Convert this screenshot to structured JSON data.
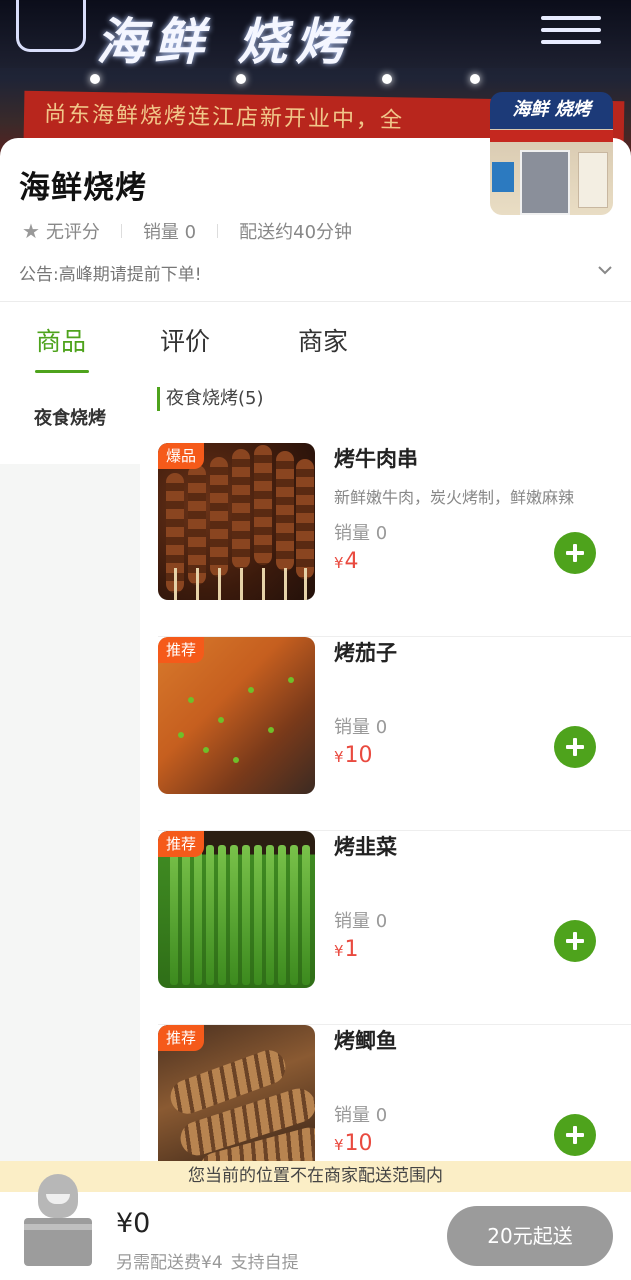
{
  "shop": {
    "name": "海鲜烧烤",
    "rating": "无评分",
    "sales": "销量 0",
    "delivery_time": "配送约40分钟",
    "notice": "公告:高峰期请提前下单!"
  },
  "banner": {
    "sign_text": "海鲜 烧烤",
    "red_banner_text": "尚东海鲜烧烤连江店新开业中，全",
    "thumbnail_sign": "海鲜 烧烤"
  },
  "tabs": [
    {
      "label": "商品",
      "active": true
    },
    {
      "label": "评价",
      "active": false
    },
    {
      "label": "商家",
      "active": false
    }
  ],
  "sidebar": {
    "items": [
      {
        "label": "夜食烧烤",
        "active": true
      }
    ]
  },
  "category": {
    "title": "夜食烧烤(5)"
  },
  "items": [
    {
      "badge": "爆品",
      "name": "烤牛肉串",
      "desc": "新鲜嫩牛肉，炭火烤制，鲜嫩麻辣",
      "sales": "销量 0",
      "currency": "¥",
      "price": "4"
    },
    {
      "badge": "推荐",
      "name": "烤茄子",
      "desc": "",
      "sales": "销量 0",
      "currency": "¥",
      "price": "10"
    },
    {
      "badge": "推荐",
      "name": "烤韭菜",
      "desc": "",
      "sales": "销量 0",
      "currency": "¥",
      "price": "1"
    },
    {
      "badge": "推荐",
      "name": "烤鲫鱼",
      "desc": "",
      "sales": "销量 0",
      "currency": "¥",
      "price": "10"
    }
  ],
  "range_notice": "您当前的位置不在商家配送范围内",
  "cart": {
    "total": "¥0",
    "delivery_fee": "另需配送费¥4",
    "pickup": "支持自提",
    "min_order_label": "20元起送"
  },
  "colors": {
    "accent": "#4ea31c",
    "price": "#e94a3f",
    "badge": "#f55a1a",
    "notice_bg": "#fbeec6"
  }
}
